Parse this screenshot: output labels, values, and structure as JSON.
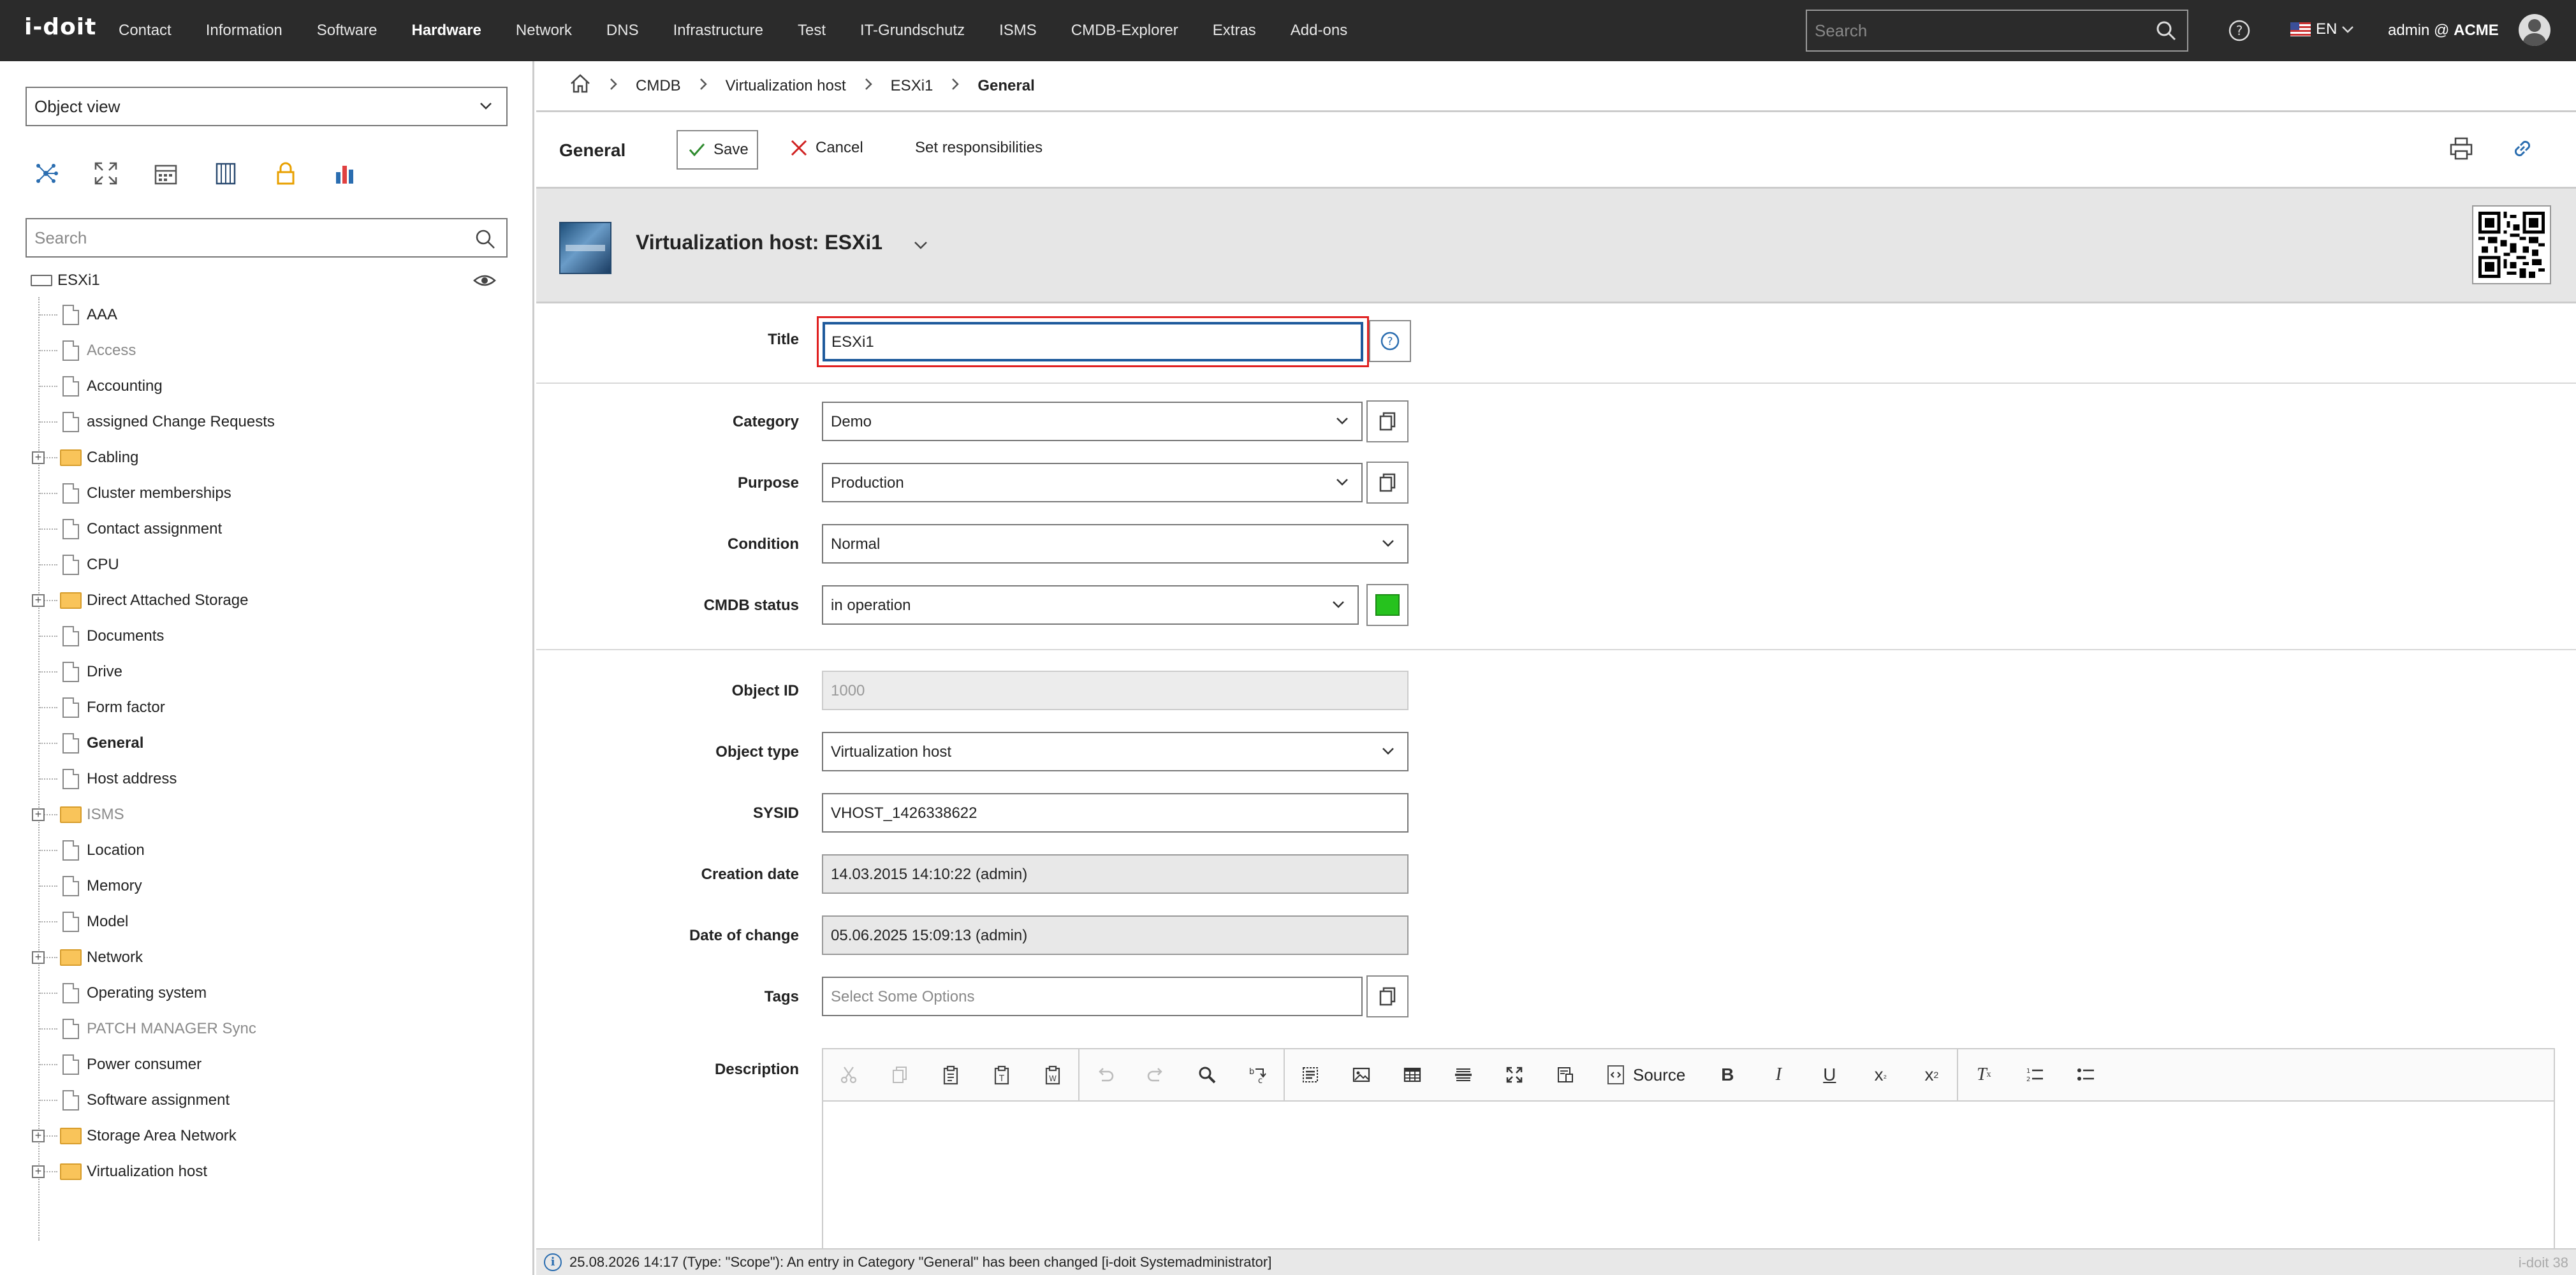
{
  "app": {
    "logo": "i-doit",
    "version": "i-doit 38"
  },
  "topnav": {
    "items": [
      "Contact",
      "Information",
      "Software",
      "Hardware",
      "Network",
      "DNS",
      "Infrastructure",
      "Test",
      "IT-Grundschutz",
      "ISMS",
      "CMDB-Explorer",
      "Extras",
      "Add-ons"
    ],
    "active": "Hardware",
    "search_placeholder": "Search",
    "language": "EN",
    "user_prefix": "admin @",
    "tenant": "ACME"
  },
  "sidebar": {
    "view_select": "Object view",
    "search_placeholder": "Search",
    "root": "ESXi1",
    "items": [
      {
        "label": "AAA",
        "kind": "file",
        "style": "normal"
      },
      {
        "label": "Access",
        "kind": "file",
        "style": "muted"
      },
      {
        "label": "Accounting",
        "kind": "file",
        "style": "normal"
      },
      {
        "label": "assigned Change Requests",
        "kind": "file",
        "style": "normal"
      },
      {
        "label": "Cabling",
        "kind": "folder",
        "style": "normal"
      },
      {
        "label": "Cluster memberships",
        "kind": "file",
        "style": "normal"
      },
      {
        "label": "Contact assignment",
        "kind": "file",
        "style": "normal"
      },
      {
        "label": "CPU",
        "kind": "file",
        "style": "normal"
      },
      {
        "label": "Direct Attached Storage",
        "kind": "folder",
        "style": "normal"
      },
      {
        "label": "Documents",
        "kind": "file",
        "style": "normal"
      },
      {
        "label": "Drive",
        "kind": "file",
        "style": "normal"
      },
      {
        "label": "Form factor",
        "kind": "file",
        "style": "normal"
      },
      {
        "label": "General",
        "kind": "file",
        "style": "bold"
      },
      {
        "label": "Host address",
        "kind": "file",
        "style": "normal"
      },
      {
        "label": "ISMS",
        "kind": "folder",
        "style": "muted"
      },
      {
        "label": "Location",
        "kind": "file",
        "style": "normal"
      },
      {
        "label": "Memory",
        "kind": "file",
        "style": "normal"
      },
      {
        "label": "Model",
        "kind": "file",
        "style": "normal"
      },
      {
        "label": "Network",
        "kind": "folder",
        "style": "normal"
      },
      {
        "label": "Operating system",
        "kind": "file",
        "style": "normal"
      },
      {
        "label": "PATCH MANAGER Sync",
        "kind": "file",
        "style": "muted"
      },
      {
        "label": "Power consumer",
        "kind": "file",
        "style": "normal"
      },
      {
        "label": "Software assignment",
        "kind": "file",
        "style": "normal"
      },
      {
        "label": "Storage Area Network",
        "kind": "folder",
        "style": "normal"
      },
      {
        "label": "Virtualization host",
        "kind": "folder",
        "style": "normal"
      }
    ]
  },
  "breadcrumb": [
    "CMDB",
    "Virtualization host",
    "ESXi1",
    "General"
  ],
  "toolbar": {
    "title": "General",
    "save_label": "Save",
    "cancel_label": "Cancel",
    "responsibilities_label": "Set responsibilities"
  },
  "object": {
    "title": "Virtualization host: ESXi1"
  },
  "form": {
    "title_label": "Title",
    "title_value": "ESXi1",
    "category_label": "Category",
    "category_value": "Demo",
    "purpose_label": "Purpose",
    "purpose_value": "Production",
    "condition_label": "Condition",
    "condition_value": "Normal",
    "cmdb_status_label": "CMDB status",
    "cmdb_status_value": "in operation",
    "cmdb_status_color": "#26c21e",
    "object_id_label": "Object ID",
    "object_id_value": "1000",
    "object_type_label": "Object type",
    "object_type_value": "Virtualization host",
    "sysid_label": "SYSID",
    "sysid_value": "VHOST_1426338622",
    "creation_date_label": "Creation date",
    "creation_date_value": "14.03.2015 14:10:22 (admin)",
    "date_of_change_label": "Date of change",
    "date_of_change_value": "05.06.2025 15:09:13 (admin)",
    "tags_label": "Tags",
    "tags_placeholder": "Select Some Options",
    "description_label": "Description",
    "editor_source_label": "Source"
  },
  "status": {
    "message": "25.08.2026 14:17 (Type: \"Scope\"): An entry in Category \"General\" has been changed [i-doit Systemadministrator]"
  }
}
